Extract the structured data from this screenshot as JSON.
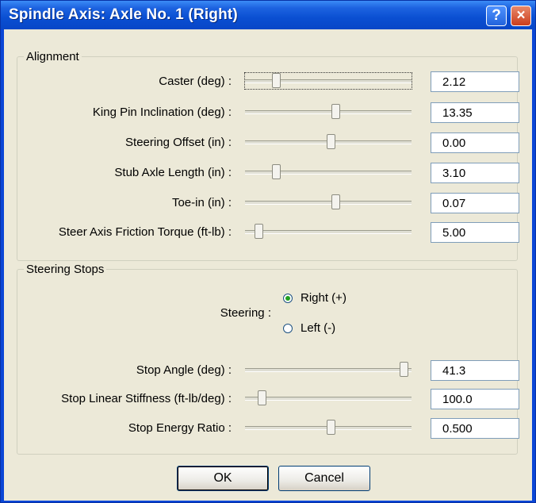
{
  "window": {
    "title": "Spindle Axis:  Axle No. 1 (Right)",
    "help_label": "?",
    "close_label": "×"
  },
  "alignment": {
    "legend": "Alignment",
    "rows": [
      {
        "label": "Caster (deg) :",
        "value": "2.12",
        "slider_fraction": 0.17
      },
      {
        "label": "King Pin Inclination (deg) :",
        "value": "13.35",
        "slider_fraction": 0.55
      },
      {
        "label": "Steering Offset (in) :",
        "value": "0.00",
        "slider_fraction": 0.52
      },
      {
        "label": "Stub Axle Length (in) :",
        "value": "3.10",
        "slider_fraction": 0.17
      },
      {
        "label": "Toe-in (in) :",
        "value": "0.07",
        "slider_fraction": 0.55
      },
      {
        "label": "Steer Axis Friction Torque (ft-lb) :",
        "value": "5.00",
        "slider_fraction": 0.06
      }
    ]
  },
  "steering_stops": {
    "legend": "Steering Stops",
    "steering_label": "Steering :",
    "options": [
      {
        "label": "Right (+)",
        "selected": true
      },
      {
        "label": "Left (-)",
        "selected": false
      }
    ],
    "rows": [
      {
        "label": "Stop Angle (deg) :",
        "value": "41.3",
        "slider_fraction": 0.98
      },
      {
        "label": "Stop Linear Stiffness (ft-lb/deg) :",
        "value": "100.0",
        "slider_fraction": 0.08
      },
      {
        "label": "Stop Energy Ratio :",
        "value": "0.500",
        "slider_fraction": 0.52
      }
    ]
  },
  "buttons": {
    "ok": "OK",
    "cancel": "Cancel"
  }
}
